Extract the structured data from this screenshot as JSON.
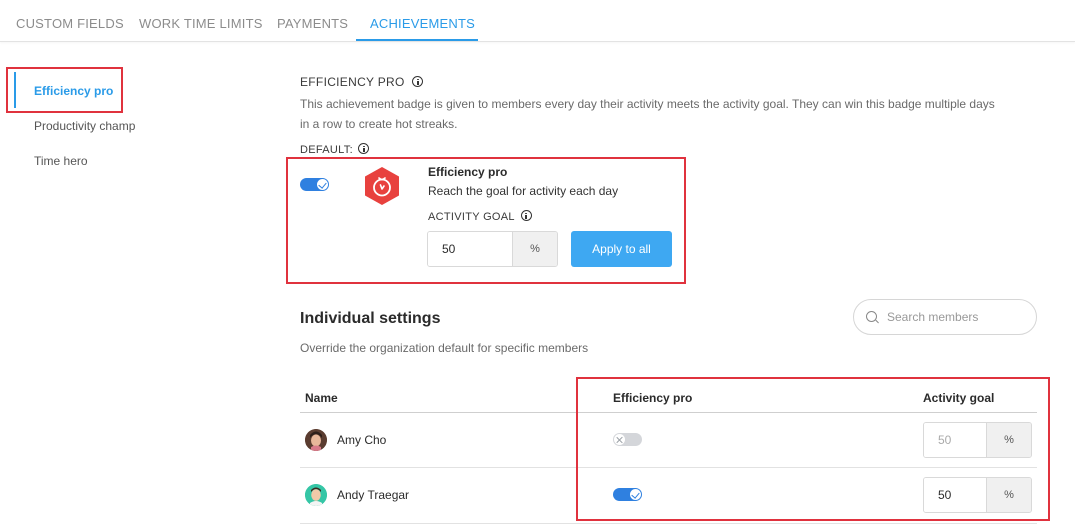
{
  "tabs": [
    {
      "label": "CUSTOM FIELDS",
      "active": false
    },
    {
      "label": "WORK TIME LIMITS",
      "active": false
    },
    {
      "label": "PAYMENTS",
      "active": false
    },
    {
      "label": "ACHIEVEMENTS",
      "active": true
    }
  ],
  "sidebar": {
    "items": [
      {
        "label": "Efficiency pro",
        "active": true
      },
      {
        "label": "Productivity champ",
        "active": false
      },
      {
        "label": "Time hero",
        "active": false
      }
    ]
  },
  "main": {
    "section_title": "EFFICIENCY PRO",
    "description_line1": "This achievement badge is given to members every day their activity meets the activity goal. They can win this badge multiple days",
    "description_line2": "in a row to create hot streaks.",
    "default_label": "DEFAULT:",
    "default": {
      "enabled": true,
      "badge_icon": "flame-hexagon-icon",
      "badge_color": "#e8413e",
      "badge_title": "Efficiency pro",
      "badge_subtitle": "Reach the goal for activity each day",
      "activity_goal_label": "ACTIVITY GOAL",
      "activity_goal_value": "50",
      "unit": "%",
      "apply_button": "Apply to all"
    },
    "individual": {
      "title": "Individual settings",
      "subtitle": "Override the organization default for specific members",
      "search_placeholder": "Search members",
      "columns": {
        "name": "Name",
        "efficiency": "Efficiency pro",
        "goal": "Activity goal"
      },
      "members": [
        {
          "name": "Amy Cho",
          "enabled": false,
          "goal": "50",
          "unit": "%"
        },
        {
          "name": "Andy Traegar",
          "enabled": true,
          "goal": "50",
          "unit": "%"
        }
      ]
    }
  },
  "colors": {
    "accent": "#2a9be8",
    "toggle_on": "#2f80e0",
    "button": "#3ea8f2",
    "annotation": "#e0323e"
  }
}
